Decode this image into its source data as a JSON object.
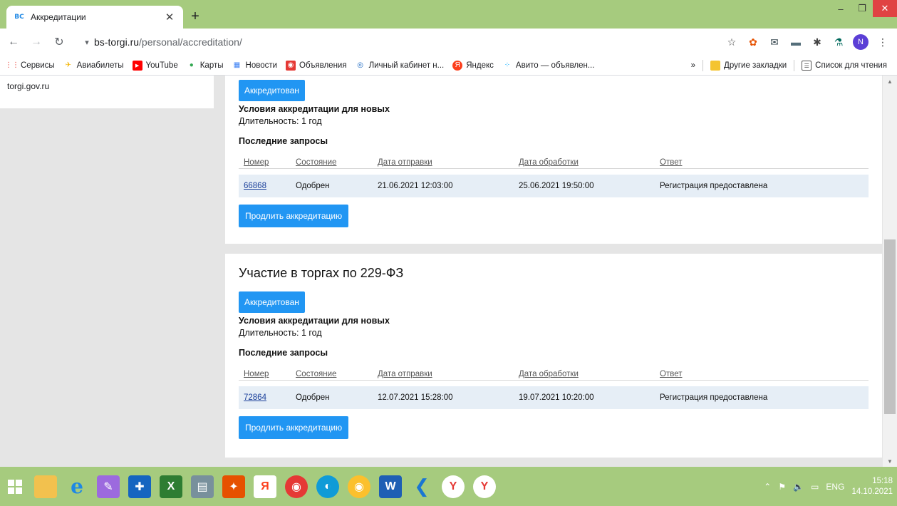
{
  "browser": {
    "tab_title": "Аккредитации",
    "favicon_text": "BC",
    "url_host": "bs-torgi.ru",
    "url_path": "/personal/accreditation/",
    "avatar_letter": "N"
  },
  "bookmarks": [
    {
      "label": "Сервисы",
      "icon": "apps-grid-icon",
      "color": "#e8453c"
    },
    {
      "label": "Авиабилеты",
      "icon": "plane-icon",
      "color": "#f4b400"
    },
    {
      "label": "YouTube",
      "icon": "youtube-icon",
      "color": "#ff0000"
    },
    {
      "label": "Карты",
      "icon": "map-pin-icon",
      "color": "#34a853"
    },
    {
      "label": "Новости",
      "icon": "news-icon",
      "color": "#4285f4"
    },
    {
      "label": "Объявления",
      "icon": "ads-icon",
      "color": "#e53935"
    },
    {
      "label": "Личный кабинет н...",
      "icon": "cabinet-icon",
      "color": "#1565c0"
    },
    {
      "label": "Яндекс",
      "icon": "yandex-icon",
      "color": "#fc3f1d"
    },
    {
      "label": "Авито — объявлен...",
      "icon": "avito-icon",
      "color": "#00aaff"
    }
  ],
  "bookmarks_right": {
    "more": "»",
    "other": "Другие закладки",
    "reading_list": "Список для чтения"
  },
  "left_panel": {
    "link": "torgi.gov.ru"
  },
  "cards": [
    {
      "title": "",
      "status": "Аккредитован",
      "conditions": "Условия аккредитации для новых",
      "duration": "Длительность: 1 год",
      "requests_title": "Последние запросы",
      "headers": [
        "Номер",
        "Состояние",
        "Дата отправки",
        "Дата обработки",
        "Ответ"
      ],
      "row": [
        "66868",
        "Одобрен",
        "21.06.2021 12:03:00",
        "25.06.2021 19:50:00",
        "Регистрация предоставлена"
      ],
      "extend_button": "Продлить аккредитацию"
    },
    {
      "title": "Участие в торгах по 229-ФЗ",
      "status": "Аккредитован",
      "conditions": "Условия аккредитации для новых",
      "duration": "Длительность: 1 год",
      "requests_title": "Последние запросы",
      "headers": [
        "Номер",
        "Состояние",
        "Дата отправки",
        "Дата обработки",
        "Ответ"
      ],
      "row": [
        "72864",
        "Одобрен",
        "12.07.2021 15:28:00",
        "19.07.2021 10:20:00",
        "Регистрация предоставлена"
      ],
      "extend_button": "Продлить аккредитацию"
    }
  ],
  "taskbar": {
    "lang": "ENG",
    "time": "15:18",
    "date": "14.10.2021"
  }
}
